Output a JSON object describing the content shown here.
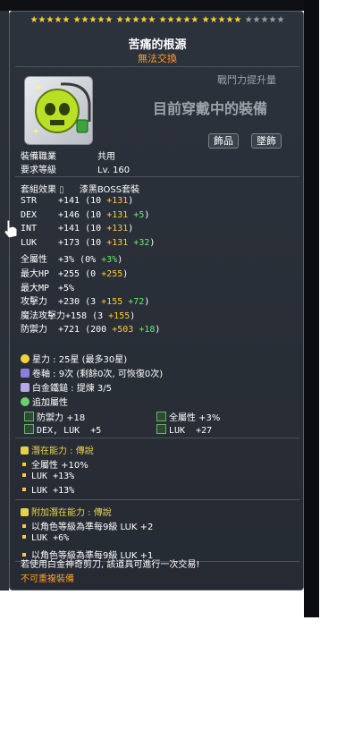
{
  "item": {
    "stars_on": "★★★★★ ★★★★★ ★★★★★ ★★★★★ ★★★★★",
    "stars_off": "★★★★★",
    "name": "苦痛的根源",
    "trade": "無法交換",
    "combat_power_label": "戰鬥力提升量",
    "currently_equipped": "目前穿戴中的裝備",
    "tags": [
      "飾品",
      "墜飾"
    ],
    "job_label": "裝備職業",
    "job_value": "共用",
    "level_label": "要求等級",
    "level_value": "Lv. 160",
    "set_label": "套組效果",
    "set_value": "漆黑BOSS套裝"
  },
  "stats": [
    {
      "name": "STR",
      "base": "+141",
      "open": "(10 ",
      "star": "+131",
      "extra": "",
      "close": ")"
    },
    {
      "name": "DEX",
      "base": "+146",
      "open": "(10 ",
      "star": "+131",
      "extra": " +5",
      "close": ")"
    },
    {
      "name": "INT",
      "base": "+141",
      "open": "(10 ",
      "star": "+131",
      "extra": "",
      "close": ")"
    },
    {
      "name": "LUK",
      "base": "+173",
      "open": "(10 ",
      "star": "+131",
      "extra": " +32",
      "close": ")"
    },
    {
      "name": "全屬性",
      "base": "+3%",
      "open": "(0% ",
      "star": "",
      "extra": "+3%",
      "close": ")"
    },
    {
      "name": "最大HP",
      "base": "+255",
      "open": "(0 ",
      "star": "+255",
      "extra": "",
      "close": ")"
    },
    {
      "name": "最大MP",
      "base": "+5%",
      "open": "",
      "star": "",
      "extra": "",
      "close": ""
    },
    {
      "name": "攻擊力",
      "base": "+230",
      "open": "(3 ",
      "star": "+155",
      "extra": " +72",
      "close": ")"
    },
    {
      "name": "魔法攻擊力",
      "base": "+158",
      "open": "(3 ",
      "star": "+155",
      "extra": "",
      "close": ")"
    },
    {
      "name": "防禦力",
      "base": "+721",
      "open": "(200 ",
      "star": "+503",
      "extra": " +18",
      "close": ")"
    }
  ],
  "enhance": {
    "starforce": "星力 : 25星 (最多30星)",
    "scroll": "卷軸 : 9次 (剩餘0次, 可恢復0次)",
    "hammer": "白金鐵鎚 : 提煉 3/5",
    "bonus_label": "追加屬性",
    "bonus": [
      {
        "left": "防禦力 +18",
        "right": "全屬性 +3%"
      },
      {
        "left": "DEX, LUK  +5",
        "right": "LUK  +27"
      }
    ]
  },
  "potential": {
    "label": "潛在能力 : 傳說",
    "lines": [
      "全屬性 +10%",
      "LUK +13%",
      "LUK +13%"
    ]
  },
  "additional": {
    "label": "附加潛在能力 : 傳說",
    "lines": [
      "以角色等級為準每9級 LUK +2",
      "LUK +6%",
      "以角色等級為準每9級 LUK +1"
    ]
  },
  "footer": {
    "scissors": "若使用白金神奇剪刀, 該道具可進行一次交易!",
    "unique": "不可重複裝備"
  },
  "colors": {
    "gold": "#ffcc33",
    "green": "#66ee66",
    "orange": "#ff9a2a",
    "potential": "#e6d24a"
  }
}
